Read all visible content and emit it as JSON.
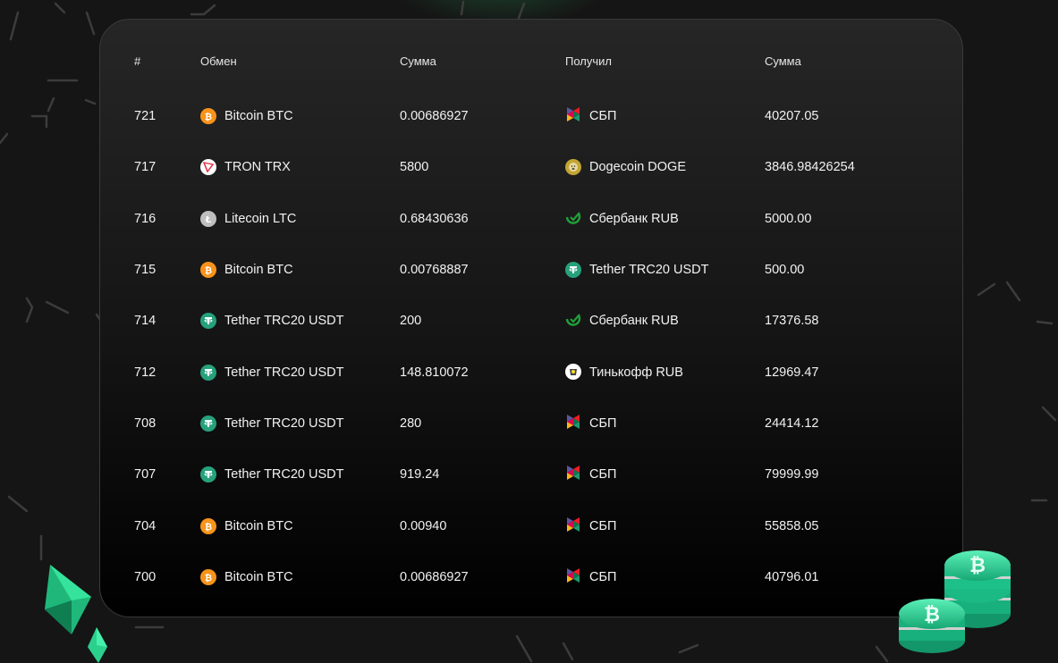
{
  "table": {
    "headers": {
      "id": "#",
      "from": "Обмен",
      "amount_from": "Сумма",
      "to": "Получил",
      "amount_to": "Сумма"
    },
    "rows": [
      {
        "id": "721",
        "from": "Bitcoin BTC",
        "from_icon": "bitcoin-icon",
        "amount_from": "0.00686927",
        "to": "СБП",
        "to_icon": "sbp-icon",
        "amount_to": "40207.05"
      },
      {
        "id": "717",
        "from": "TRON TRX",
        "from_icon": "tron-icon",
        "amount_from": "5800",
        "to": "Dogecoin DOGE",
        "to_icon": "dogecoin-icon",
        "amount_to": "3846.98426254"
      },
      {
        "id": "716",
        "from": "Litecoin LTC",
        "from_icon": "litecoin-icon",
        "amount_from": "0.68430636",
        "to": "Сбербанк RUB",
        "to_icon": "sberbank-icon",
        "amount_to": "5000.00"
      },
      {
        "id": "715",
        "from": "Bitcoin BTC",
        "from_icon": "bitcoin-icon",
        "amount_from": "0.00768887",
        "to": "Tether TRC20 USDT",
        "to_icon": "tether-icon",
        "amount_to": "500.00"
      },
      {
        "id": "714",
        "from": "Tether TRC20 USDT",
        "from_icon": "tether-icon",
        "amount_from": "200",
        "to": "Сбербанк RUB",
        "to_icon": "sberbank-icon",
        "amount_to": "17376.58"
      },
      {
        "id": "712",
        "from": "Tether TRC20 USDT",
        "from_icon": "tether-icon",
        "amount_from": "148.810072",
        "to": "Тинькофф RUB",
        "to_icon": "tinkoff-icon",
        "amount_to": "12969.47"
      },
      {
        "id": "708",
        "from": "Tether TRC20 USDT",
        "from_icon": "tether-icon",
        "amount_from": "280",
        "to": "СБП",
        "to_icon": "sbp-icon",
        "amount_to": "24414.12"
      },
      {
        "id": "707",
        "from": "Tether TRC20 USDT",
        "from_icon": "tether-icon",
        "amount_from": "919.24",
        "to": "СБП",
        "to_icon": "sbp-icon",
        "amount_to": "79999.99"
      },
      {
        "id": "704",
        "from": "Bitcoin BTC",
        "from_icon": "bitcoin-icon",
        "amount_from": "0.00940",
        "to": "СБП",
        "to_icon": "sbp-icon",
        "amount_to": "55858.05"
      },
      {
        "id": "700",
        "from": "Bitcoin BTC",
        "from_icon": "bitcoin-icon",
        "amount_from": "0.00686927",
        "to": "СБП",
        "to_icon": "sbp-icon",
        "amount_to": "40796.01"
      }
    ]
  },
  "colors": {
    "bitcoin": "#f7931a",
    "tether": "#26a17b",
    "tron": "#e5283e",
    "litecoin": "#bfbfbf",
    "sberbank": "#21a038",
    "dogecoin": "#c2a633",
    "accent_green": "#2ecf8a"
  }
}
